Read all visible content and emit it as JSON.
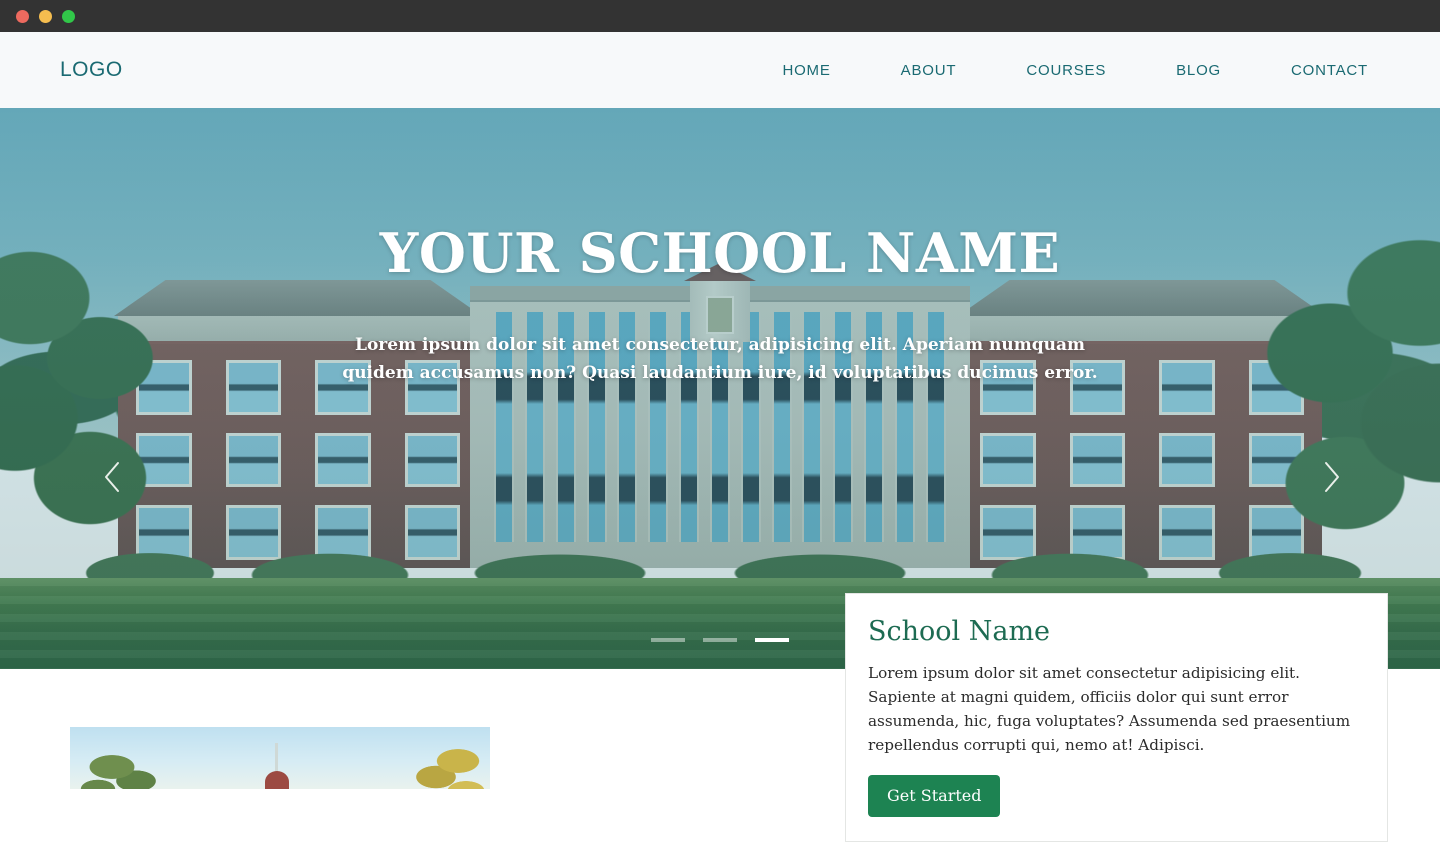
{
  "window": {
    "traffic_lights": [
      {
        "name": "close",
        "color": "#ed6a5f"
      },
      {
        "name": "minimize",
        "color": "#f5bd4f"
      },
      {
        "name": "maximize",
        "color": "#31c749"
      }
    ]
  },
  "header": {
    "logo": "LOGO",
    "nav": [
      {
        "label": "HOME"
      },
      {
        "label": "ABOUT"
      },
      {
        "label": "COURSES"
      },
      {
        "label": "BLOG"
      },
      {
        "label": "CONTACT"
      }
    ]
  },
  "hero": {
    "title": "YOUR SCHOOL NAME",
    "subtitle_line1": "Lorem ipsum dolor sit amet consectetur, adipisicing elit. Aperiam numquam quidem accusamus non?",
    "subtitle_line2": "Quasi laudantium iure, id voluptatibus ducimus error.",
    "prev_icon": "chevron-left-icon",
    "next_icon": "chevron-right-icon",
    "slides": [
      {
        "index": 1,
        "active": false
      },
      {
        "index": 2,
        "active": false
      },
      {
        "index": 3,
        "active": true
      }
    ],
    "image_alt": "campus-building-lawn"
  },
  "info_card": {
    "title": "School Name",
    "body": "Lorem ipsum dolor sit amet consectetur adipisicing elit. Sapiente at magni quidem, officiis dolor qui sunt error assumenda, hic, fuga voluptates? Assumenda sed praesentium repellendus corrupti qui, nemo at! Adipisci.",
    "cta_label": "Get Started"
  },
  "section": {
    "thumbnail_alt": "campus-chapel-photo"
  },
  "colors": {
    "accent_green": "#1d8352",
    "heading_green": "#1d6b52",
    "nav_teal": "#1a6a72",
    "header_bg": "#f7f9fa",
    "titlebar_bg": "#333333"
  }
}
